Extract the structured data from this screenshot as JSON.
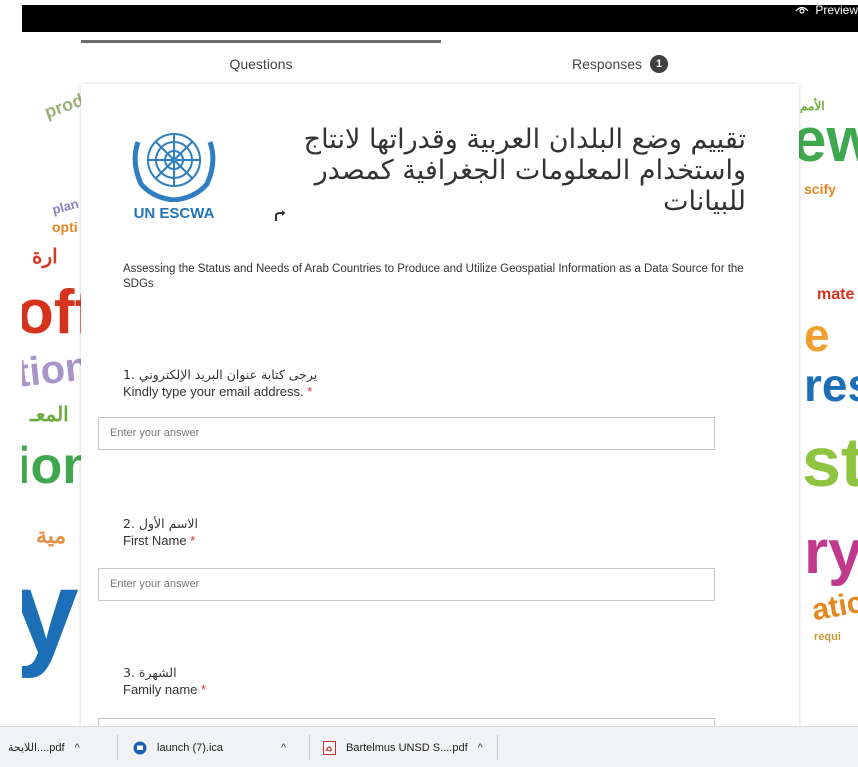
{
  "header": {
    "preview_label": "Preview"
  },
  "tabs": {
    "questions_label": "Questions",
    "responses_label": "Responses",
    "responses_count": "1"
  },
  "form": {
    "logo_text": "UN ESCWA",
    "title": "تقييم وضع البلدان العربية وقدراتها لانتاج واستخدام المعلومات الجغرافية كمصدر للبيانات",
    "description": "Assessing the Status and Needs of Arab Countries to Produce and Utilize Geospatial Information as a Data Source for the SDGs",
    "questions": [
      {
        "arabic": "يرجى كتابة عنوان البريد الإلكتروني .1",
        "english": "Kindly type your email address.",
        "required_mark": "*",
        "placeholder": "Enter your answer"
      },
      {
        "arabic": "الاسم الأول .2",
        "english": "First Name",
        "required_mark": "*",
        "placeholder": "Enter your answer"
      },
      {
        "arabic": "الشهرة .3",
        "english": "Family name",
        "required_mark": "*"
      }
    ]
  },
  "downloads": [
    {
      "label": "اللايحة....pdf"
    },
    {
      "label": "launch (7).ica"
    },
    {
      "label": "Bartelmus UNSD S....pdf"
    }
  ],
  "colors": {
    "accent": "#2473b9",
    "required": "#d13438"
  }
}
